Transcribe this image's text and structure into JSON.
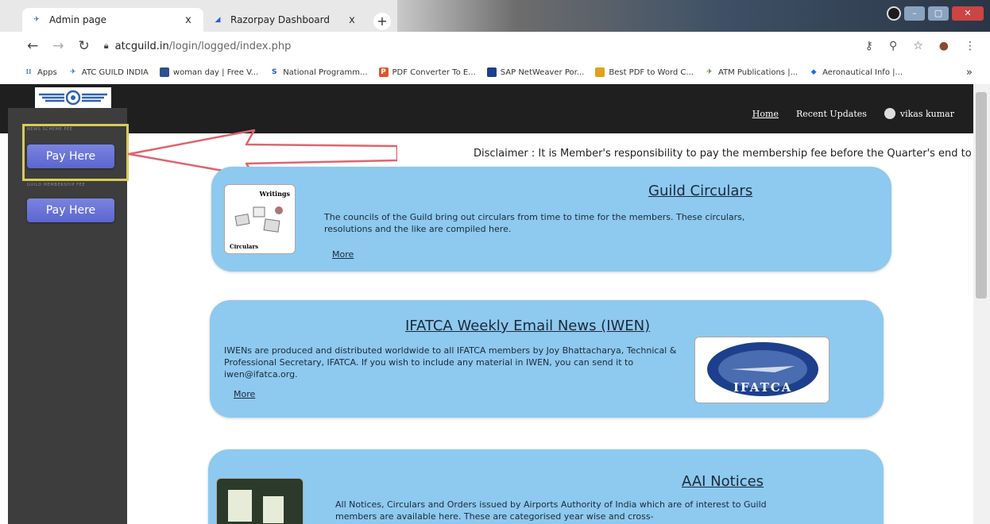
{
  "browser": {
    "tabs": [
      {
        "title": "Admin page",
        "close": "x"
      },
      {
        "title": "Razorpay Dashboard",
        "close": "x"
      }
    ],
    "new_tab": "+",
    "url_host": "atcguild.in",
    "url_path": "/login/logged/index.php",
    "bookmarks": [
      {
        "label": "Apps",
        "icon": "apps-grid-icon",
        "color": "#1a73e8"
      },
      {
        "label": "ATC GUILD INDIA",
        "icon": "atc-guild-favicon",
        "color": "#2b6cb0"
      },
      {
        "label": "woman day | Free V...",
        "icon": "photo-site-icon",
        "color": "#2d4f8f"
      },
      {
        "label": "National Programm...",
        "icon": "s-site-icon",
        "color": "#1a56c4"
      },
      {
        "label": "PDF Converter To E...",
        "icon": "pdf-converter-icon",
        "color": "#e0542b"
      },
      {
        "label": "SAP NetWeaver Por...",
        "icon": "sap-icon",
        "color": "#1c3f8f"
      },
      {
        "label": "Best PDF to Word C...",
        "icon": "pdf-word-icon",
        "color": "#e0a020"
      },
      {
        "label": "ATM Publications |...",
        "icon": "atm-icon",
        "color": "#4a7a2a"
      },
      {
        "label": "Aeronautical Info |...",
        "icon": "aero-info-icon",
        "color": "#1a73e8"
      }
    ],
    "bookmarks_more": "»"
  },
  "header": {
    "nav": {
      "home": "Home",
      "updates": "Recent Updates",
      "user": "vikas kumar"
    }
  },
  "sidebar": {
    "section1_label": "NEWS SCHEME FEE",
    "section2_label": "GUILD MEMBERSHIP FEE",
    "pay1": "Pay Here",
    "pay2": "Pay Here"
  },
  "disclaimer": "Disclaimer : It is Member's responsibility to pay the membership fee before the Quarter's end to",
  "cards": {
    "circulars": {
      "title": "Guild Circulars",
      "text": "The councils of the Guild bring out circulars from time to time for the members. These circulars, resolutions and the like are compiled here.",
      "more": "More",
      "thumb_top": "Writings",
      "thumb_bottom": "Circulars"
    },
    "iwen": {
      "title": "IFATCA Weekly Email News (IWEN)",
      "text": "IWENs are produced and distributed worldwide to all IFATCA members by Joy Bhattacharya, Technical & Professional Secretary, IFATCA. If you wish to include any material in IWEN, you can send it to iwen@ifatca.org.",
      "more": "More",
      "logo_text": "IFATCA"
    },
    "aai": {
      "title": "AAI Notices",
      "text": "All Notices, Circulars and Orders issued by Airports Authority of India which are of interest to Guild members are available here. These are categorised year wise and cross-"
    }
  },
  "colors": {
    "card_blue": "#8ec9ef",
    "topbar": "#1f1f1f",
    "sidebar": "#3d3d3d",
    "pay_button": "#6670d8",
    "highlight_box": "#d9cc55",
    "arrow": "#e0646e"
  }
}
